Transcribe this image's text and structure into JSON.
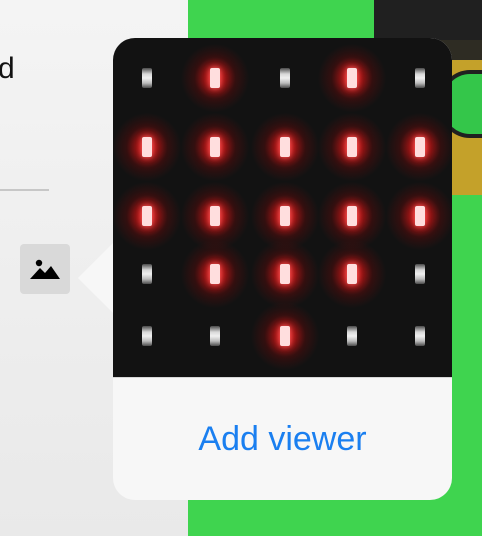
{
  "left_panel": {
    "partial_text": "d"
  },
  "icons": {
    "image_button": "image-icon"
  },
  "popover": {
    "matrix": {
      "rows": 5,
      "cols": 5,
      "lit_color": "#ff2020",
      "pattern": [
        [
          0,
          1,
          0,
          1,
          0
        ],
        [
          1,
          1,
          1,
          1,
          1
        ],
        [
          1,
          1,
          1,
          1,
          1
        ],
        [
          0,
          1,
          1,
          1,
          0
        ],
        [
          0,
          0,
          1,
          0,
          0
        ]
      ]
    },
    "action_label": "Add viewer"
  },
  "colors": {
    "accent": "#1a7ff0",
    "background_green": "#3fd44f",
    "board_gold": "#c4a12a"
  }
}
